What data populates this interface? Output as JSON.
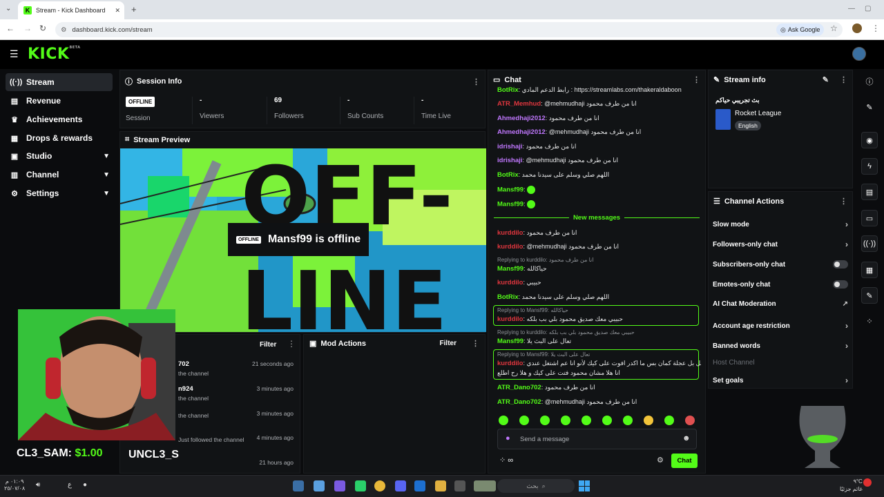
{
  "browser": {
    "tab_title": "Stream - Kick Dashboard",
    "url": "dashboard.kick.com/stream",
    "ask_google": "Ask Google"
  },
  "header": {
    "logo": "KICK",
    "beta": "BETA"
  },
  "sidebar": {
    "items": [
      {
        "label": "Stream",
        "icon": "stream-icon"
      },
      {
        "label": "Revenue",
        "icon": "revenue-icon"
      },
      {
        "label": "Achievements",
        "icon": "trophy-icon"
      },
      {
        "label": "Drops & rewards",
        "icon": "drops-icon"
      },
      {
        "label": "Studio",
        "icon": "studio-icon"
      },
      {
        "label": "Channel",
        "icon": "channel-icon"
      },
      {
        "label": "Settings",
        "icon": "gear-icon"
      }
    ]
  },
  "session": {
    "title": "Session Info",
    "status": "OFFLINE",
    "status_label": "Session",
    "stats": [
      {
        "value": "-",
        "label": "Viewers"
      },
      {
        "value": "69",
        "label": "Followers"
      },
      {
        "value": "-",
        "label": "Sub Counts"
      },
      {
        "value": "-",
        "label": "Time Live"
      }
    ]
  },
  "preview": {
    "title": "Stream Preview",
    "badge": "OFFLINE",
    "message": "Mansf99 is offline",
    "art_text_1": "OFF-",
    "art_text_2": "LINE"
  },
  "activity": {
    "filter": "Filter",
    "rows": [
      {
        "name": "702",
        "sub": "the channel",
        "time": "21 seconds ago"
      },
      {
        "name": "n924",
        "sub": "the channel",
        "time": "3 minutes ago"
      },
      {
        "name": "",
        "sub": "the channel",
        "time": "3 minutes ago"
      },
      {
        "name": "",
        "sub": "Just followed the channel",
        "time": "4 minutes ago"
      },
      {
        "name": "",
        "sub": "",
        "time": "21 hours ago"
      }
    ]
  },
  "mod_actions": {
    "title": "Mod Actions",
    "filter": "Filter"
  },
  "webcam": {
    "donation_name": "CL3_SAM:",
    "donation_amount": "$1.00",
    "overlay_name": "UNCL3_S"
  },
  "chat": {
    "title": "Chat",
    "messages": [
      {
        "user": "BotRix",
        "color": "#53fc18",
        "text": ": رابط الدعم المادي : https://streamlabs.com/thakeraldaboon"
      },
      {
        "user": "ATR_Memhud",
        "color": "#e0363e",
        "text": ": @mehmudhaji انا من طرف محمود"
      },
      {
        "user": "Ahmedhaji2012",
        "color": "#c178ff",
        "text": ": انا من طرف محمود"
      },
      {
        "user": "Ahmedhaji2012",
        "color": "#c178ff",
        "text": ": @mehmudhaji انا من طرف محمود"
      },
      {
        "user": "idrishaji",
        "color": "#c178ff",
        "text": ": انا من طرف محمود"
      },
      {
        "user": "idrishaji",
        "color": "#c178ff",
        "text": ": @mehmudhaji انا من طرف محمود"
      },
      {
        "user": "BotRix",
        "color": "#53fc18",
        "text": ": اللهم صلي وسلم على سيدنا محمد"
      },
      {
        "user": "Mansf99",
        "color": "#53fc18",
        "text": ":"
      },
      {
        "user": "Mansf99",
        "color": "#53fc18",
        "text": ":"
      }
    ],
    "new_messages": "New messages",
    "new": [
      {
        "user": "kurddilo",
        "color": "#e0363e",
        "text": ": انا من طرف محمود"
      },
      {
        "user": "kurddilo",
        "color": "#e0363e",
        "text": ": @mehmudhaji انا من طرف محمود"
      },
      {
        "reply": "Replying to kurddilo: انا من طرف محمود",
        "user": "Mansf99",
        "color": "#53fc18",
        "text": ": حياكالله"
      },
      {
        "user": "kurddilo",
        "color": "#e0363e",
        "text": ": حبيبي"
      },
      {
        "user": "BotRix",
        "color": "#53fc18",
        "text": ": اللهم صلي وسلم على سيدنا محمد"
      },
      {
        "reply": "Replying to Mansf99: حياكالله",
        "user": "kurddilo",
        "color": "#e0363e",
        "text": ": حبيبي معك صديق محمود بلي بب بلكه"
      },
      {
        "reply": "Replying to kurddilo: حبيبي معك صديق محمود بلي بب بلكه",
        "user": "Mansf99",
        "color": "#53fc18",
        "text": ": تعال على البث يلا"
      },
      {
        "reply": "Replying to Mansf99: تعال على البث يلا",
        "user": "kurddilo",
        "color": "#e0363e",
        "text": ": متابعك و مسجل بل عجلة كمان بس ما اكدر افوت على كيك لأنو انا عم اشتغل عندي",
        "text2": "انا هلا مشان محمود فتت على كيك و هلا رح اطلع"
      },
      {
        "user": "ATR_Dano702",
        "color": "#53fc18",
        "text": ": انا من طرف محمود"
      },
      {
        "user": "ATR_Dano702",
        "color": "#53fc18",
        "text": ": @mehmudhaji انا من طرف محمود"
      }
    ],
    "input_placeholder": "Send a message",
    "send_label": "Chat"
  },
  "stream_info": {
    "title": "Stream info",
    "stream_title": "بث تجريبي حياكم",
    "category": "Rocket League",
    "language": "English"
  },
  "channel_actions": {
    "title": "Channel Actions",
    "items": [
      {
        "label": "Slow mode",
        "control": "chevron"
      },
      {
        "label": "Followers-only chat",
        "control": "chevron"
      },
      {
        "label": "Subscribers-only chat",
        "control": "toggle"
      },
      {
        "label": "Emotes-only chat",
        "control": "toggle"
      },
      {
        "label": "AI Chat Moderation",
        "control": "external"
      },
      {
        "label": "Account age restriction",
        "control": "chevron"
      },
      {
        "label": "Banned words",
        "control": "chevron"
      },
      {
        "label": "Host Channel",
        "control": "none"
      },
      {
        "label": "Set goals",
        "control": "chevron"
      }
    ]
  },
  "taskbar": {
    "search_placeholder": "بحث",
    "time": "٠١:٠٩ م",
    "date": "٢٥/٠٧/٠٨",
    "weather_temp": "٩°C",
    "weather_desc": "غائم جزئيًا",
    "lang": "ع"
  },
  "colors": {
    "accent": "#53fc18",
    "bg": "#0b0c0e",
    "panel": "#111315"
  }
}
